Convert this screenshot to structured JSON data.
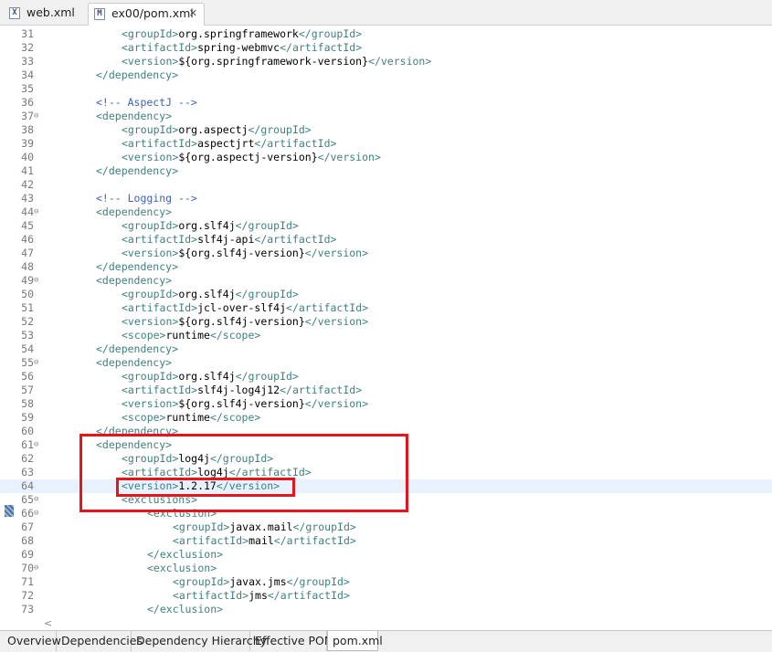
{
  "tabs": [
    {
      "label": "web.xml",
      "icon": "xml-file-icon",
      "active": false
    },
    {
      "label": "ex00/pom.xml",
      "icon": "maven-pom-icon",
      "active": true
    }
  ],
  "tab_close_glyph": "✕",
  "fold_glyph": "⊖",
  "scroll_glyph": "<",
  "editor": {
    "lines": [
      {
        "n": "31",
        "fold": false,
        "indent": 12,
        "parts": [
          [
            "tag",
            "<groupId>"
          ],
          [
            "txt",
            "org.springframework"
          ],
          [
            "tag",
            "</groupId>"
          ]
        ]
      },
      {
        "n": "32",
        "fold": false,
        "indent": 12,
        "parts": [
          [
            "tag",
            "<artifactId>"
          ],
          [
            "txt",
            "spring-webmvc"
          ],
          [
            "tag",
            "</artifactId>"
          ]
        ]
      },
      {
        "n": "33",
        "fold": false,
        "indent": 12,
        "parts": [
          [
            "tag",
            "<version>"
          ],
          [
            "txt",
            "${org.springframework-version}"
          ],
          [
            "tag",
            "</version>"
          ]
        ]
      },
      {
        "n": "34",
        "fold": false,
        "indent": 8,
        "parts": [
          [
            "tag",
            "</dependency>"
          ]
        ]
      },
      {
        "n": "35",
        "fold": false,
        "indent": 0,
        "parts": []
      },
      {
        "n": "36",
        "fold": false,
        "indent": 8,
        "parts": [
          [
            "cm",
            "<!-- AspectJ -->"
          ]
        ]
      },
      {
        "n": "37",
        "fold": true,
        "indent": 8,
        "parts": [
          [
            "tag",
            "<dependency>"
          ]
        ]
      },
      {
        "n": "38",
        "fold": false,
        "indent": 12,
        "parts": [
          [
            "tag",
            "<groupId>"
          ],
          [
            "txt",
            "org.aspectj"
          ],
          [
            "tag",
            "</groupId>"
          ]
        ]
      },
      {
        "n": "39",
        "fold": false,
        "indent": 12,
        "parts": [
          [
            "tag",
            "<artifactId>"
          ],
          [
            "txt",
            "aspectjrt"
          ],
          [
            "tag",
            "</artifactId>"
          ]
        ]
      },
      {
        "n": "40",
        "fold": false,
        "indent": 12,
        "parts": [
          [
            "tag",
            "<version>"
          ],
          [
            "txt",
            "${org.aspectj-version}"
          ],
          [
            "tag",
            "</version>"
          ]
        ]
      },
      {
        "n": "41",
        "fold": false,
        "indent": 8,
        "parts": [
          [
            "tag",
            "</dependency>"
          ]
        ]
      },
      {
        "n": "42",
        "fold": false,
        "indent": 0,
        "parts": []
      },
      {
        "n": "43",
        "fold": false,
        "indent": 8,
        "parts": [
          [
            "cm",
            "<!-- Logging -->"
          ]
        ]
      },
      {
        "n": "44",
        "fold": true,
        "indent": 8,
        "parts": [
          [
            "tag",
            "<dependency>"
          ]
        ]
      },
      {
        "n": "45",
        "fold": false,
        "indent": 12,
        "parts": [
          [
            "tag",
            "<groupId>"
          ],
          [
            "txt",
            "org.slf4j"
          ],
          [
            "tag",
            "</groupId>"
          ]
        ]
      },
      {
        "n": "46",
        "fold": false,
        "indent": 12,
        "parts": [
          [
            "tag",
            "<artifactId>"
          ],
          [
            "txt",
            "slf4j-api"
          ],
          [
            "tag",
            "</artifactId>"
          ]
        ]
      },
      {
        "n": "47",
        "fold": false,
        "indent": 12,
        "parts": [
          [
            "tag",
            "<version>"
          ],
          [
            "txt",
            "${org.slf4j-version}"
          ],
          [
            "tag",
            "</version>"
          ]
        ]
      },
      {
        "n": "48",
        "fold": false,
        "indent": 8,
        "parts": [
          [
            "tag",
            "</dependency>"
          ]
        ]
      },
      {
        "n": "49",
        "fold": true,
        "indent": 8,
        "parts": [
          [
            "tag",
            "<dependency>"
          ]
        ]
      },
      {
        "n": "50",
        "fold": false,
        "indent": 12,
        "parts": [
          [
            "tag",
            "<groupId>"
          ],
          [
            "txt",
            "org.slf4j"
          ],
          [
            "tag",
            "</groupId>"
          ]
        ]
      },
      {
        "n": "51",
        "fold": false,
        "indent": 12,
        "parts": [
          [
            "tag",
            "<artifactId>"
          ],
          [
            "txt",
            "jcl-over-slf4j"
          ],
          [
            "tag",
            "</artifactId>"
          ]
        ]
      },
      {
        "n": "52",
        "fold": false,
        "indent": 12,
        "parts": [
          [
            "tag",
            "<version>"
          ],
          [
            "txt",
            "${org.slf4j-version}"
          ],
          [
            "tag",
            "</version>"
          ]
        ]
      },
      {
        "n": "53",
        "fold": false,
        "indent": 12,
        "parts": [
          [
            "tag",
            "<scope>"
          ],
          [
            "txt",
            "runtime"
          ],
          [
            "tag",
            "</scope>"
          ]
        ]
      },
      {
        "n": "54",
        "fold": false,
        "indent": 8,
        "parts": [
          [
            "tag",
            "</dependency>"
          ]
        ]
      },
      {
        "n": "55",
        "fold": true,
        "indent": 8,
        "parts": [
          [
            "tag",
            "<dependency>"
          ]
        ]
      },
      {
        "n": "56",
        "fold": false,
        "indent": 12,
        "parts": [
          [
            "tag",
            "<groupId>"
          ],
          [
            "txt",
            "org.slf4j"
          ],
          [
            "tag",
            "</groupId>"
          ]
        ]
      },
      {
        "n": "57",
        "fold": false,
        "indent": 12,
        "parts": [
          [
            "tag",
            "<artifactId>"
          ],
          [
            "txt",
            "slf4j-log4j12"
          ],
          [
            "tag",
            "</artifactId>"
          ]
        ]
      },
      {
        "n": "58",
        "fold": false,
        "indent": 12,
        "parts": [
          [
            "tag",
            "<version>"
          ],
          [
            "txt",
            "${org.slf4j-version}"
          ],
          [
            "tag",
            "</version>"
          ]
        ]
      },
      {
        "n": "59",
        "fold": false,
        "indent": 12,
        "parts": [
          [
            "tag",
            "<scope>"
          ],
          [
            "txt",
            "runtime"
          ],
          [
            "tag",
            "</scope>"
          ]
        ]
      },
      {
        "n": "60",
        "fold": false,
        "indent": 8,
        "parts": [
          [
            "tag",
            "</dependency>"
          ]
        ]
      },
      {
        "n": "61",
        "fold": true,
        "indent": 8,
        "parts": [
          [
            "tag",
            "<dependency>"
          ]
        ]
      },
      {
        "n": "62",
        "fold": false,
        "indent": 12,
        "parts": [
          [
            "tag",
            "<groupId>"
          ],
          [
            "txt",
            "log4j"
          ],
          [
            "tag",
            "</groupId>"
          ]
        ]
      },
      {
        "n": "63",
        "fold": false,
        "indent": 12,
        "parts": [
          [
            "tag",
            "<artifactId>"
          ],
          [
            "txt",
            "log4j"
          ],
          [
            "tag",
            "</artifactId>"
          ]
        ]
      },
      {
        "n": "64",
        "fold": false,
        "indent": 12,
        "current": true,
        "parts": [
          [
            "tag",
            "<version>"
          ],
          [
            "txt",
            "1.2.17"
          ],
          [
            "tag",
            "</version>"
          ]
        ]
      },
      {
        "n": "65",
        "fold": true,
        "indent": 12,
        "parts": [
          [
            "tag",
            "<exclusions>"
          ]
        ]
      },
      {
        "n": "66",
        "fold": true,
        "indent": 16,
        "parts": [
          [
            "tag",
            "<exclusion>"
          ]
        ]
      },
      {
        "n": "67",
        "fold": false,
        "indent": 20,
        "parts": [
          [
            "tag",
            "<groupId>"
          ],
          [
            "txt",
            "javax.mail"
          ],
          [
            "tag",
            "</groupId>"
          ]
        ]
      },
      {
        "n": "68",
        "fold": false,
        "indent": 20,
        "parts": [
          [
            "tag",
            "<artifactId>"
          ],
          [
            "txt",
            "mail"
          ],
          [
            "tag",
            "</artifactId>"
          ]
        ]
      },
      {
        "n": "69",
        "fold": false,
        "indent": 16,
        "parts": [
          [
            "tag",
            "</exclusion>"
          ]
        ]
      },
      {
        "n": "70",
        "fold": true,
        "indent": 16,
        "parts": [
          [
            "tag",
            "<exclusion>"
          ]
        ]
      },
      {
        "n": "71",
        "fold": false,
        "indent": 20,
        "parts": [
          [
            "tag",
            "<groupId>"
          ],
          [
            "txt",
            "javax.jms"
          ],
          [
            "tag",
            "</groupId>"
          ]
        ]
      },
      {
        "n": "72",
        "fold": false,
        "indent": 20,
        "parts": [
          [
            "tag",
            "<artifactId>"
          ],
          [
            "txt",
            "jms"
          ],
          [
            "tag",
            "</artifactId>"
          ]
        ]
      },
      {
        "n": "73",
        "fold": false,
        "indent": 16,
        "parts": [
          [
            "tag",
            "</exclusion>"
          ]
        ]
      }
    ]
  },
  "bottom_tabs": [
    {
      "label": "Overview",
      "active": false
    },
    {
      "label": "Dependencies",
      "active": false
    },
    {
      "label": "Dependency Hierarchy",
      "active": false
    },
    {
      "label": "Effective POM",
      "active": false
    },
    {
      "label": "pom.xml",
      "active": true
    }
  ],
  "colors": {
    "tag": "#3f7f7f",
    "comment": "#3f5fbf",
    "text": "#000000",
    "highlight_box": "#e8141c",
    "current_line": "#e8f2fe"
  }
}
